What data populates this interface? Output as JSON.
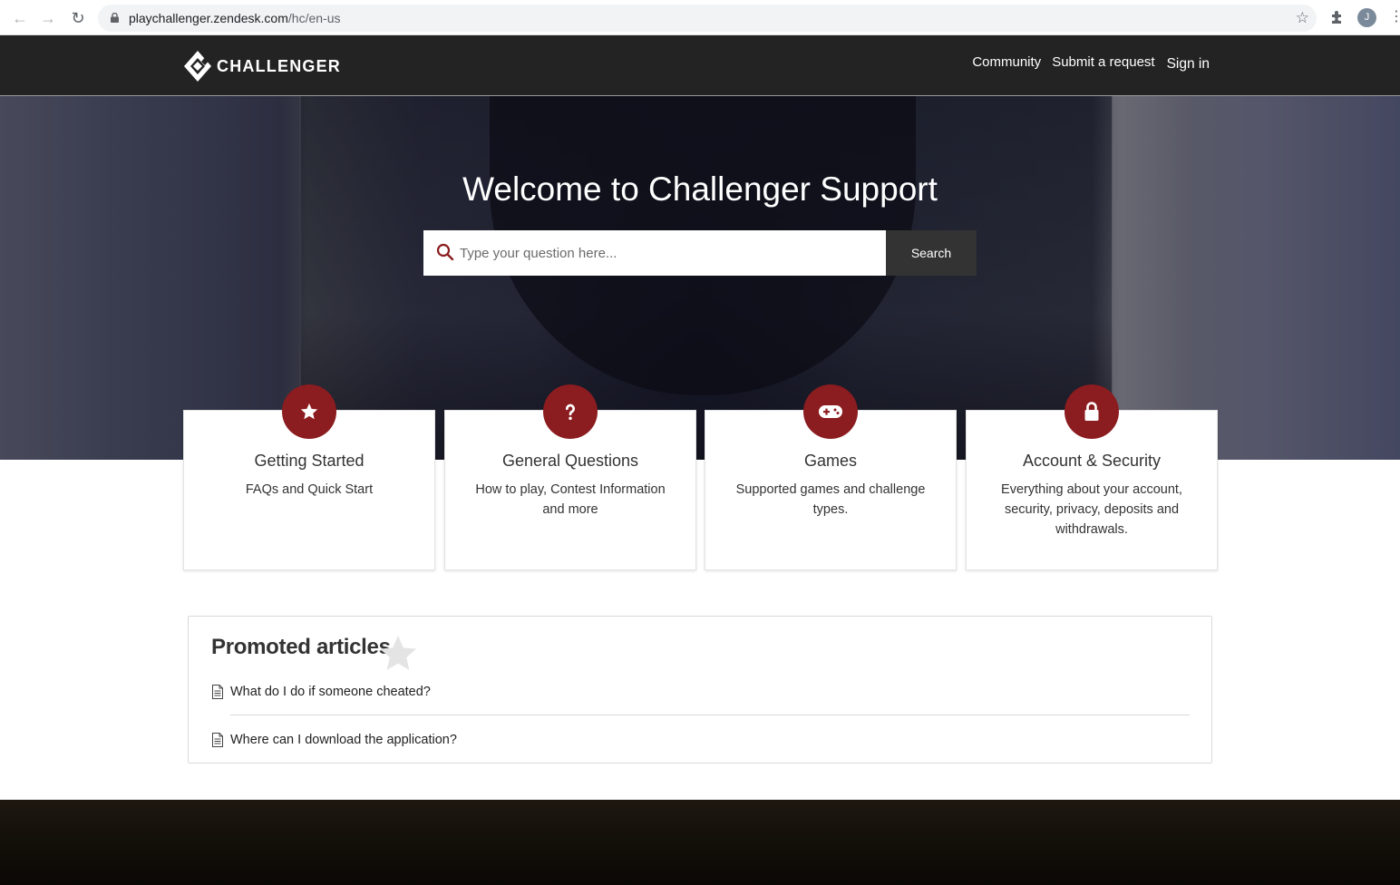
{
  "browser": {
    "url_host": "playchallenger.zendesk.com",
    "url_path": "/hc/en-us",
    "profile_initial": "J"
  },
  "header": {
    "logo_text": "CHALLENGER",
    "nav": {
      "community": "Community",
      "submit_request": "Submit a request",
      "sign_in": "Sign in"
    }
  },
  "hero": {
    "title": "Welcome to Challenger Support",
    "search_placeholder": "Type your question here...",
    "search_button": "Search"
  },
  "categories": [
    {
      "icon": "star-icon",
      "title": "Getting Started",
      "description": "FAQs and Quick Start"
    },
    {
      "icon": "question-icon",
      "title": "General Questions",
      "description": "How to play, Contest Information and more"
    },
    {
      "icon": "gamepad-icon",
      "title": "Games",
      "description": "Supported games and challenge types."
    },
    {
      "icon": "lock-icon",
      "title": "Account & Security",
      "description": "Everything about your account, security, privacy, deposits and withdrawals."
    }
  ],
  "promoted": {
    "title": "Promoted articles",
    "articles": [
      {
        "title": "What do I do if someone cheated?"
      },
      {
        "title": "Where can I download the application?"
      }
    ]
  },
  "colors": {
    "accent": "#8b1c1f",
    "header_bg": "#232323",
    "button_bg": "#333333"
  }
}
